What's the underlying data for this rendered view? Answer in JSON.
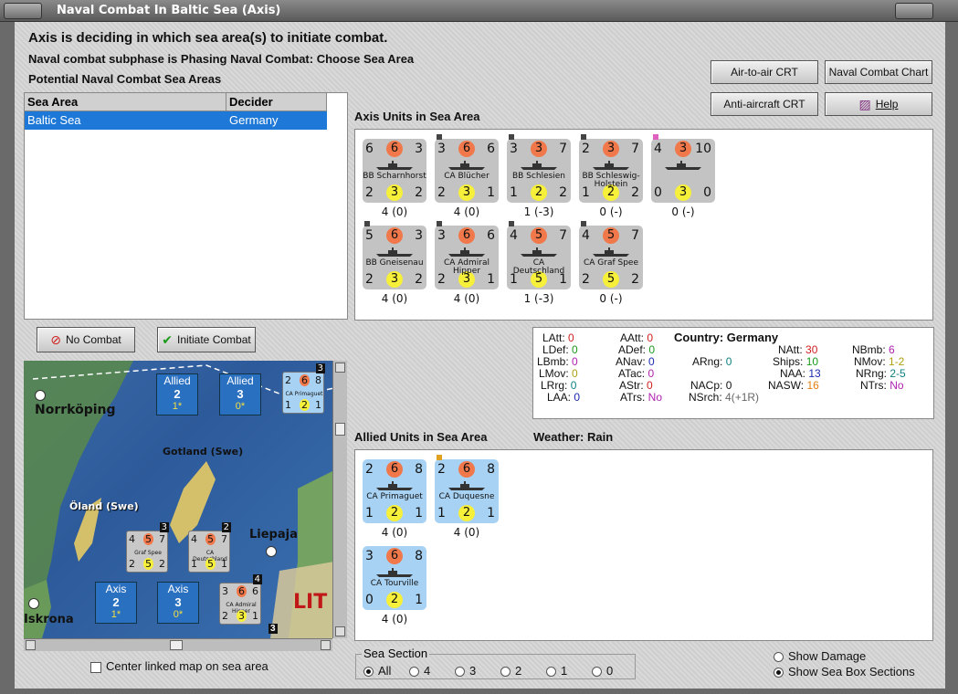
{
  "window": {
    "title": "Naval Combat In Baltic Sea (Axis)"
  },
  "header": {
    "status": "Axis is deciding in which sea area(s) to initiate combat.",
    "subphase": "Naval combat subphase is Phasing Naval Combat: Choose Sea Area",
    "potential": "Potential Naval Combat Sea Areas"
  },
  "sea_table": {
    "columns": [
      "Sea Area",
      "Decider"
    ],
    "rows": [
      {
        "area": "Baltic Sea",
        "decider": "Germany"
      }
    ]
  },
  "buttons": {
    "air_to_air": "Air-to-air CRT",
    "naval_chart": "Naval Combat Chart",
    "anti_aircraft": "Anti-aircraft CRT",
    "help": "Help",
    "no_combat": "No Combat",
    "initiate_combat": "Initiate Combat"
  },
  "axis": {
    "label": "Axis Units in Sea Area",
    "units": [
      {
        "tl": "6",
        "top": "6",
        "tr": "3",
        "name": "BB Scharnhorst",
        "bl": "2",
        "bot": "3",
        "br": "2",
        "hits": "4 (0)"
      },
      {
        "tl": "3",
        "top": "6",
        "tr": "6",
        "name": "CA Blücher",
        "bl": "2",
        "bot": "3",
        "br": "1",
        "hits": "4 (0)"
      },
      {
        "tl": "3",
        "top": "3",
        "tr": "7",
        "name": "BB Schlesien",
        "bl": "1",
        "bot": "2",
        "br": "2",
        "hits": "1 (-3)"
      },
      {
        "tl": "2",
        "top": "3",
        "tr": "7",
        "name": "BB Schleswig-Holstein",
        "bl": "1",
        "bot": "2",
        "br": "2",
        "hits": "0 (-)"
      },
      {
        "tl": "4",
        "top": "3",
        "tr": "10",
        "name": "",
        "bl": "0",
        "bot": "3",
        "br": "0",
        "hits": "0 (-)"
      },
      {
        "tl": "5",
        "top": "6",
        "tr": "3",
        "name": "BB Gneisenau",
        "bl": "2",
        "bot": "3",
        "br": "2",
        "hits": "4 (0)"
      },
      {
        "tl": "3",
        "top": "6",
        "tr": "6",
        "name": "CA Admiral Hipper",
        "bl": "2",
        "bot": "3",
        "br": "1",
        "hits": "4 (0)"
      },
      {
        "tl": "4",
        "top": "5",
        "tr": "7",
        "name": "CA Deutschland",
        "bl": "1",
        "bot": "5",
        "br": "1",
        "hits": "1 (-3)"
      },
      {
        "tl": "4",
        "top": "5",
        "tr": "7",
        "name": "CA Graf Spee",
        "bl": "2",
        "bot": "5",
        "br": "2",
        "hits": "0 (-)"
      }
    ]
  },
  "stats": {
    "latt": {
      "k": "LAtt:",
      "v": "0"
    },
    "ldef": {
      "k": "LDef:",
      "v": "0"
    },
    "lbmb": {
      "k": "LBmb:",
      "v": "0"
    },
    "lmov": {
      "k": "LMov:",
      "v": "0"
    },
    "lrg": {
      "k": "LRrg:",
      "v": "0"
    },
    "laa": {
      "k": "LAA:",
      "v": "0"
    },
    "aatt": {
      "k": "AAtt:",
      "v": "0"
    },
    "adef": {
      "k": "ADef:",
      "v": "0"
    },
    "anav": {
      "k": "ANav:",
      "v": "0"
    },
    "atac": {
      "k": "ATac:",
      "v": "0"
    },
    "astr": {
      "k": "AStr:",
      "v": "0"
    },
    "atrs": {
      "k": "ATrs:",
      "v": "No"
    },
    "country": {
      "k": "Country:",
      "v": "Germany"
    },
    "arng": {
      "k": "ARng:",
      "v": "0"
    },
    "nacp": {
      "k": "NACp:",
      "v": "0"
    },
    "nsrch": {
      "k": "NSrch:",
      "v": "4(+1R)"
    },
    "natt": {
      "k": "NAtt:",
      "v": "30"
    },
    "ships": {
      "k": "Ships:",
      "v": "10"
    },
    "naa": {
      "k": "NAA:",
      "v": "13"
    },
    "nasw": {
      "k": "NASW:",
      "v": "16"
    },
    "nbmb": {
      "k": "NBmb:",
      "v": "6"
    },
    "nmov": {
      "k": "NMov:",
      "v": "1-2"
    },
    "nrng": {
      "k": "NRng:",
      "v": "2-5"
    },
    "ntrs": {
      "k": "NTrs:",
      "v": "No"
    }
  },
  "allied": {
    "label": "Allied Units in Sea Area",
    "weather_label": "Weather:",
    "weather": "Rain",
    "units": [
      {
        "tl": "2",
        "top": "6",
        "tr": "8",
        "name": "CA Primaguet",
        "bl": "1",
        "bot": "2",
        "br": "1",
        "hits": "4 (0)"
      },
      {
        "tl": "2",
        "top": "6",
        "tr": "8",
        "name": "CA Duquesne",
        "bl": "1",
        "bot": "2",
        "br": "1",
        "hits": "4 (0)"
      },
      {
        "tl": "3",
        "top": "6",
        "tr": "8",
        "name": "CA Tourville",
        "bl": "0",
        "bot": "2",
        "br": "1",
        "hits": "4 (0)"
      }
    ]
  },
  "map": {
    "labels": {
      "norrkoping": "Norrköping",
      "gotland": "Gotland (Swe)",
      "oland": "Öland (Swe)",
      "liepaja": "Liepaja",
      "karlskrona": "Iskrona",
      "lit": "LIT"
    },
    "allied_box1": {
      "title": "Allied",
      "num": "2",
      "sub": "1*"
    },
    "allied_box2": {
      "title": "Allied",
      "num": "3",
      "sub": "0*"
    },
    "axis_box1": {
      "title": "Axis",
      "num": "2",
      "sub": "1*"
    },
    "axis_box2": {
      "title": "Axis",
      "num": "3",
      "sub": "0*"
    },
    "stack_graf": {
      "count": "3",
      "tl": "4",
      "top": "5",
      "tr": "7",
      "name": "Graf Spee",
      "bl": "2",
      "bot": "5",
      "br": "2"
    },
    "stack_deutsch": {
      "count": "2",
      "tl": "4",
      "top": "5",
      "tr": "7",
      "name": "CA Deutschland",
      "bl": "1",
      "bot": "5",
      "br": "1"
    },
    "stack_hipper": {
      "count": "4",
      "tl": "3",
      "top": "6",
      "tr": "6",
      "name": "CA Admiral Hipper",
      "bl": "2",
      "bot": "3",
      "br": "1"
    },
    "stack_primaguet": {
      "count": "3",
      "tl": "2",
      "top": "6",
      "tr": "8",
      "name": "CA Primaguet",
      "bl": "1",
      "bot": "2",
      "br": "1"
    },
    "corner_count": "3"
  },
  "options": {
    "center_map": "Center linked map on sea area",
    "sea_section": "Sea Section",
    "sections": [
      "All",
      "4",
      "3",
      "2",
      "1",
      "0"
    ],
    "show_damage": "Show Damage",
    "show_sea_box": "Show Sea Box Sections"
  },
  "colors": {
    "selection": "#1e78d7",
    "axis_counter": "#c3c3c3",
    "allied_counter": "#a8d2f3",
    "attack_circle": "#f0784a",
    "defense_circle": "#f7f03a",
    "sea": "#2d5a9a"
  }
}
